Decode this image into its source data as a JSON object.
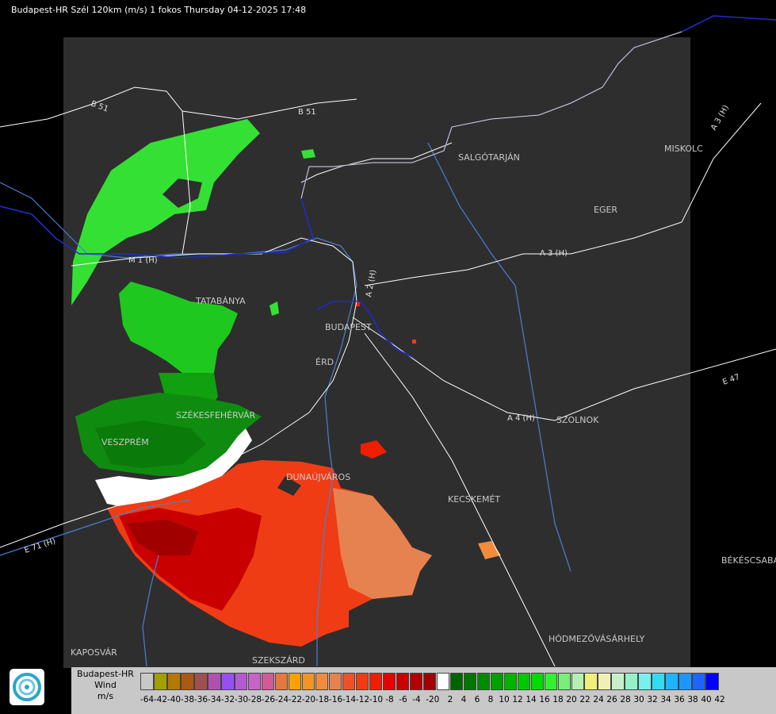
{
  "header": {
    "title": "Budapest-HR Szél 120km (m/s) 1 fokos Thursday 04-12-2025 17:48"
  },
  "map": {
    "cities": [
      "TATABÁNYA",
      "BUDAPEST",
      "ÉRD",
      "SZÉKESFEHÉRVÁR",
      "VESZPRÉM",
      "DUNAÚJVÁROS",
      "KECSKEMÉT",
      "SZOLNOK",
      "SALGÓTARJÁN",
      "EGER",
      "MISKOLC",
      "BÉKÉSCSABA",
      "HÓDMEZŐVÁSÁRHELY",
      "KAPOSVÁR",
      "SZEKSZÁRD"
    ],
    "roads": [
      "B 51",
      "B 51",
      "M 1 (H)",
      "A 2 (H)",
      "A 3 (H)",
      "A 3 (H)",
      "A 4 (H)",
      "E 47",
      "E 71 (H)"
    ],
    "colors": {
      "background": "#000000",
      "radar_area": "#2e2e2e",
      "borders": "#1e2ec8",
      "roads": "#ffffff",
      "rivers": "#4a7fd0"
    }
  },
  "legend": {
    "label_lines": [
      "Budapest-HR",
      "Wind",
      "m/s"
    ],
    "ticks": [
      "-64",
      "-42",
      "-40",
      "-38",
      "-36",
      "-34",
      "-32",
      "-30",
      "-28",
      "-26",
      "-24",
      "-22",
      "-20",
      "-18",
      "-16",
      "-14",
      "-12",
      "-10",
      "-8",
      "-6",
      "-4",
      "-2",
      "0",
      "2",
      "4",
      "6",
      "8",
      "10",
      "12",
      "14",
      "16",
      "18",
      "20",
      "22",
      "24",
      "26",
      "28",
      "30",
      "32",
      "34",
      "36",
      "38",
      "40",
      "42"
    ],
    "colors": [
      "#c8c8c8",
      "#a0a000",
      "#b47800",
      "#aa5a14",
      "#a05050",
      "#b050b0",
      "#9650f0",
      "#b45ad2",
      "#c864c8",
      "#d25a96",
      "#e6783c",
      "#ffa000",
      "#f09628",
      "#f08c3c",
      "#e68250",
      "#f05028",
      "#f03c14",
      "#f01e00",
      "#e60000",
      "#c80000",
      "#b40000",
      "#a00000",
      "#ffffff",
      "#006400",
      "#007800",
      "#008c00",
      "#00a000",
      "#00b400",
      "#00c800",
      "#00dc00",
      "#32f032",
      "#78f078",
      "#b4f0b4",
      "#f0f078",
      "#f0f0b4",
      "#c8f0c8",
      "#96f0c8",
      "#78f0f0",
      "#32dcf0",
      "#1eb4ff",
      "#1e96ff",
      "#1e64ff",
      "#0000ff"
    ],
    "logo": "hungarian-meteorological-service-logo"
  }
}
